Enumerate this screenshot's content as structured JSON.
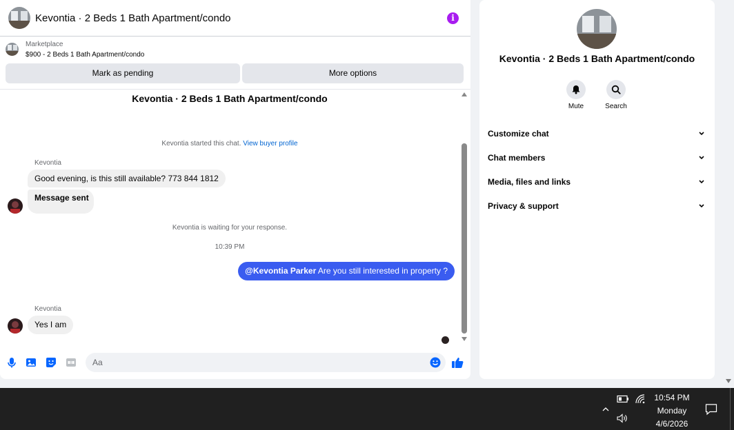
{
  "header": {
    "title": "Kevontia · 2 Beds 1 Bath Apartment/condo",
    "info_glyph": "i"
  },
  "marketplace": {
    "label": "Marketplace",
    "listing": "$900 - 2 Beds 1 Bath Apartment/condo"
  },
  "actions": {
    "mark_pending": "Mark as pending",
    "more_options": "More options"
  },
  "conversation": {
    "title": "Kevontia · 2 Beds 1 Bath Apartment/condo",
    "started_text": "Kevontia started this chat.",
    "view_profile": "View buyer profile",
    "waiting_text": "Kevontia is waiting for your response.",
    "timestamp": "10:39 PM",
    "messages": [
      {
        "sender": "Kevontia",
        "text": "Good evening, is this still available? 773 844 1812"
      },
      {
        "sender": "",
        "text": "Message sent"
      },
      {
        "sender": "me",
        "mention": "@Kevontia Parker",
        "text": " Are you still interested in property ?"
      },
      {
        "sender": "Kevontia",
        "text": "Yes I am"
      }
    ]
  },
  "composer": {
    "placeholder": "Aa"
  },
  "info_panel": {
    "name": "Kevontia · 2 Beds 1 Bath Apartment/condo",
    "mute_label": "Mute",
    "search_label": "Search",
    "sections": [
      "Customize chat",
      "Chat members",
      "Media, files and links",
      "Privacy & support"
    ]
  },
  "taskbar": {
    "time": "10:54 PM",
    "day": "Monday",
    "date": "4/6/2026"
  },
  "colors": {
    "accent": "#0866ff",
    "outgoing_bubble": "#3a5cf0",
    "info_purple": "#a81cf0",
    "link": "#0064d1"
  },
  "icons": [
    "microphone-icon",
    "image-icon",
    "sticker-icon",
    "gif-icon",
    "emoji-icon",
    "thumbs-up-icon",
    "bell-icon",
    "search-icon",
    "chevron-down-icon",
    "battery-icon",
    "wifi-icon",
    "volume-icon",
    "notification-icon"
  ]
}
